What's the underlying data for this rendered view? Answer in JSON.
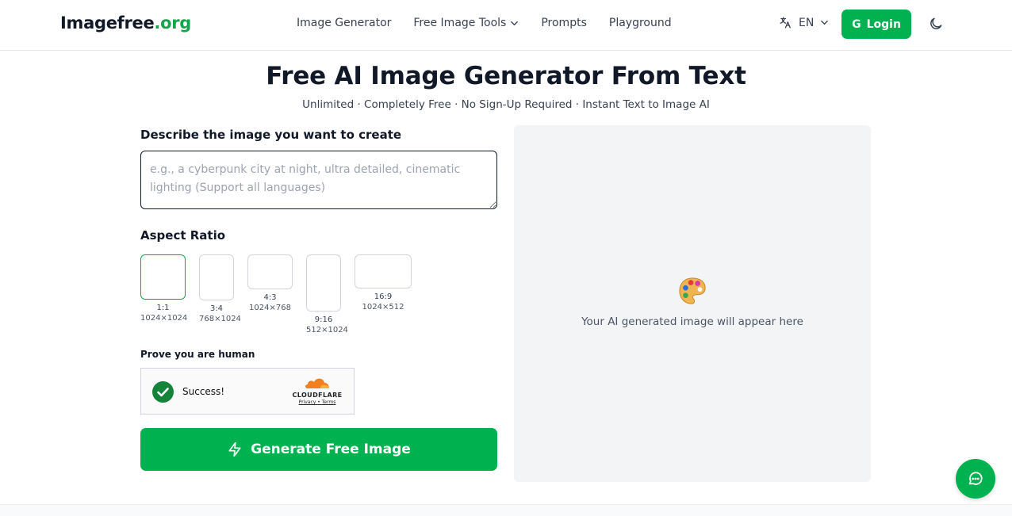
{
  "header": {
    "logo_main": "Imagefree",
    "logo_tld": ".org",
    "nav": [
      {
        "label": "Image Generator",
        "dropdown": false
      },
      {
        "label": "Free Image Tools",
        "dropdown": true
      },
      {
        "label": "Prompts",
        "dropdown": false
      },
      {
        "label": "Playground",
        "dropdown": false
      }
    ],
    "language": "EN",
    "login_label": "Login",
    "login_icon": "G"
  },
  "hero": {
    "title": "Free AI Image Generator From Text",
    "subtitle": "Unlimited · Completely Free · No Sign-Up Required · Instant Text to Image AI"
  },
  "form": {
    "prompt_label": "Describe the image you want to create",
    "prompt_placeholder": "e.g., a cyberpunk city at night, ultra detailed, cinematic lighting (Support all languages)",
    "prompt_value": "",
    "aspect_label": "Aspect Ratio",
    "ratios": [
      {
        "name": "1:1",
        "dims": "1024×1024",
        "selected": true
      },
      {
        "name": "3:4",
        "dims": "768×1024",
        "selected": false
      },
      {
        "name": "4:3",
        "dims": "1024×768",
        "selected": false
      },
      {
        "name": "9:16",
        "dims": "512×1024",
        "selected": false
      },
      {
        "name": "16:9",
        "dims": "1024×512",
        "selected": false
      }
    ],
    "human_label": "Prove you are human",
    "captcha": {
      "status": "Success!",
      "brand": "CLOUDFLARE",
      "privacy": "Privacy",
      "separator": "•",
      "terms": "Terms"
    },
    "generate_label": "Generate Free Image"
  },
  "preview": {
    "icon": "palette-icon",
    "text": "Your AI generated image will appear here"
  },
  "colors": {
    "brand_green": "#00b14f",
    "text_dark": "#111827",
    "preview_bg": "#f3f4f6"
  }
}
